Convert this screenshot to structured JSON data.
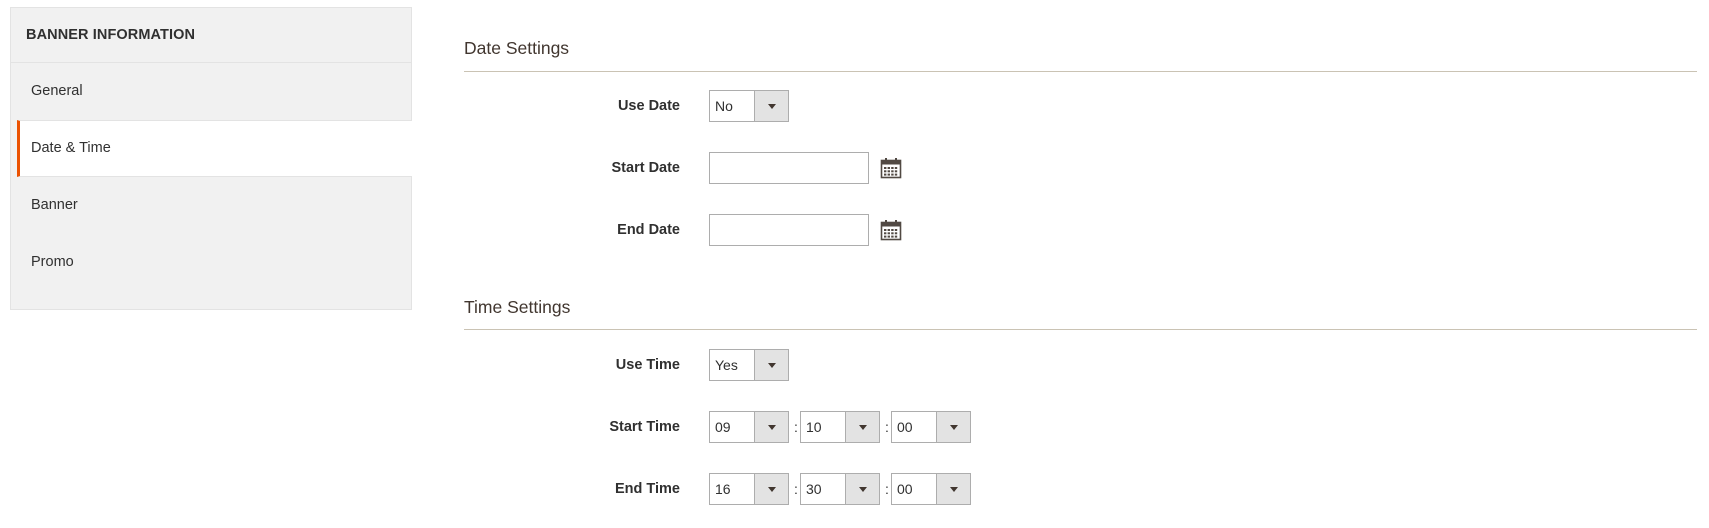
{
  "sidebar": {
    "title": "BANNER INFORMATION",
    "items": [
      {
        "label": "General",
        "active": false
      },
      {
        "label": "Date & Time",
        "active": true
      },
      {
        "label": "Banner",
        "active": false
      },
      {
        "label": "Promo",
        "active": false
      }
    ],
    "active_color": "#eb5202"
  },
  "date_settings": {
    "title": "Date Settings",
    "use_date": {
      "label": "Use Date",
      "value": "No"
    },
    "start_date": {
      "label": "Start Date",
      "value": ""
    },
    "end_date": {
      "label": "End Date",
      "value": ""
    }
  },
  "time_settings": {
    "title": "Time Settings",
    "use_time": {
      "label": "Use Time",
      "value": "Yes"
    },
    "start_time": {
      "label": "Start Time",
      "hour": "09",
      "minute": "10",
      "second": "00"
    },
    "end_time": {
      "label": "End Time",
      "hour": "16",
      "minute": "30",
      "second": "00"
    },
    "separator": ":"
  },
  "icons": {
    "calendar": "calendar-icon",
    "dropdown": "chevron-down-icon"
  }
}
